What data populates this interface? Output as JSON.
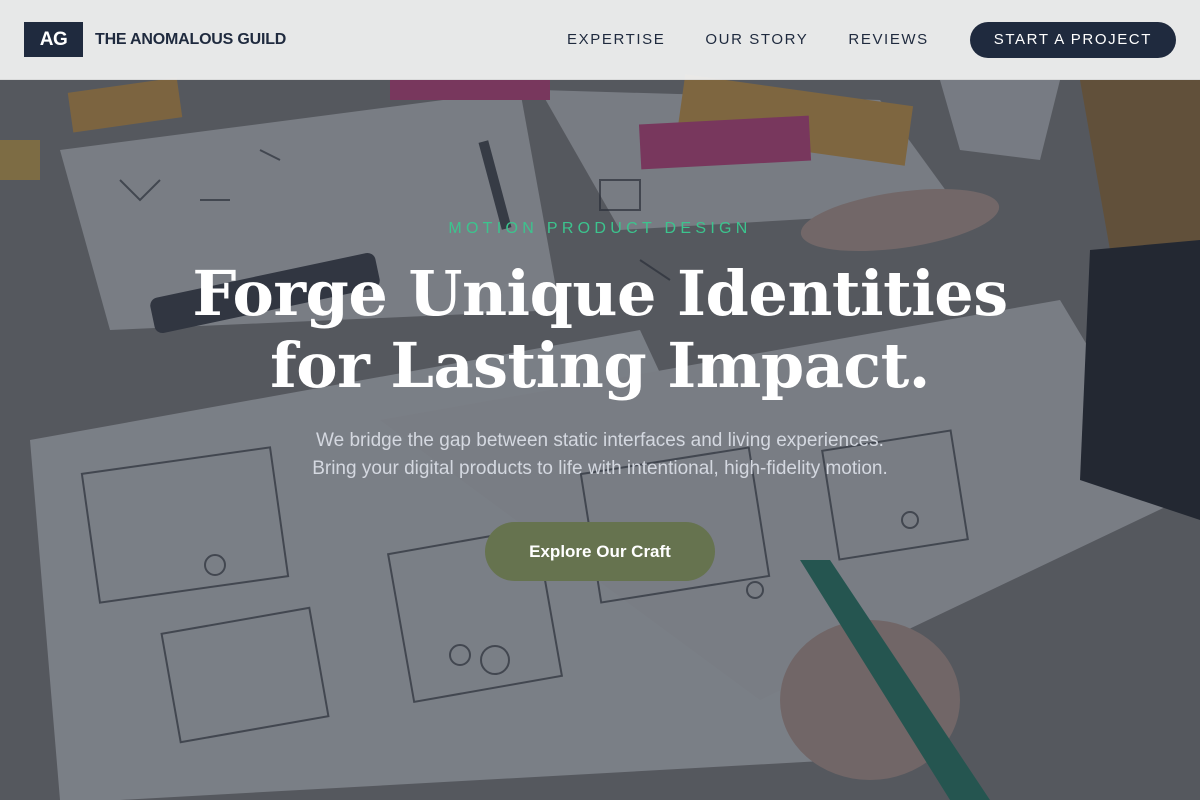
{
  "header": {
    "logo_text": "AG",
    "brand_name": "THE ANOMALOUS GUILD",
    "nav": [
      {
        "label": "EXPERTISE"
      },
      {
        "label": "OUR STORY"
      },
      {
        "label": "REVIEWS"
      }
    ],
    "cta_label": "START A PROJECT"
  },
  "hero": {
    "eyebrow": "MOTION PRODUCT DESIGN",
    "headline_line1": "Forge Unique Identities",
    "headline_line2": "for Lasting Impact.",
    "sub_line1": "We bridge the gap between static interfaces and living experiences.",
    "sub_line2": "Bring your digital products to life with intentional, high-fidelity motion.",
    "button_label": "Explore Our Craft",
    "background_image": "sketching-wireframes-photo"
  },
  "colors": {
    "navy": "#1f2a3e",
    "accent_green": "#3cc48e",
    "button_olive": "#66734f"
  }
}
